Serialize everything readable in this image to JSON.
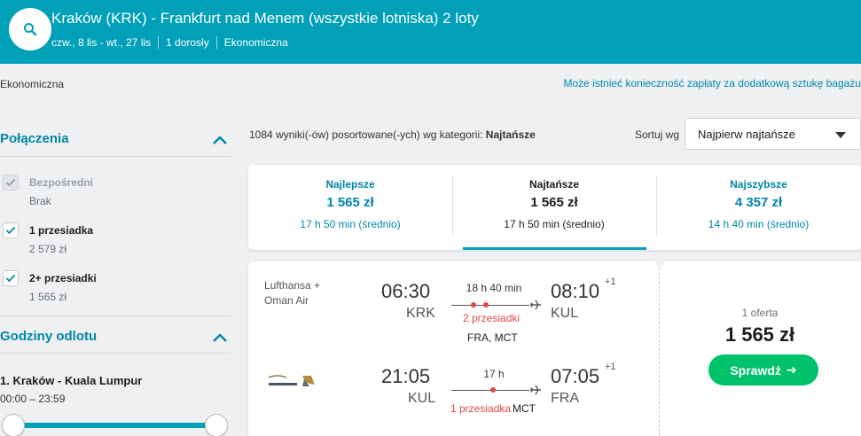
{
  "header": {
    "title": "Kraków (KRK) - Frankfurt nad Menem (wszystkie lotniska) 2 loty",
    "dates": "czw., 8 lis - wt., 27 lis",
    "travelers": "1 dorosły",
    "cabin": "Ekonomiczna"
  },
  "cabin_label": "Ekonomiczna",
  "bag_notice": "Może istnieć konieczność zapłaty za dodatkową sztukę bagażu",
  "sidebar": {
    "connections_title": "Połączenia",
    "connections": [
      {
        "label": "Bezpośredni",
        "sub": "Brak",
        "checked": true,
        "disabled": true
      },
      {
        "label": "1 przesiadka",
        "sub": "2 579 zł",
        "checked": true,
        "disabled": false
      },
      {
        "label": "2+ przesiadki",
        "sub": "1 565 zł",
        "checked": true,
        "disabled": false
      }
    ],
    "departure_title": "Godziny odlotu",
    "route_label": "1. Kraków - Kuala Lumpur",
    "time_range": "00:00 – 23:59"
  },
  "results": {
    "count_text": "1084 wyniki(-ów) posortowane(-ych) wg kategorii: ",
    "sort_category": "Najtańsze",
    "sort_label": "Sortuj wg",
    "sort_value": "Najpierw najtańsze"
  },
  "tabs": [
    {
      "title": "Najlepsze",
      "price": "1 565 zł",
      "duration": "17 h 50 min (średnio)",
      "active": false
    },
    {
      "title": "Najtańsze",
      "price": "1 565 zł",
      "duration": "17 h 50 min (średnio)",
      "active": true
    },
    {
      "title": "Najszybsze",
      "price": "4 357 zł",
      "duration": "14 h 40 min (średnio)",
      "active": false
    }
  ],
  "result": {
    "airline": "Lufthansa +\nOman Air",
    "airline_line1": "Lufthansa +",
    "airline_line2": "Oman Air",
    "legs": [
      {
        "dep_time": "06:30",
        "dep_code": "KRK",
        "arr_time": "08:10",
        "arr_code": "KUL",
        "plus_day": "+1",
        "duration": "18 h 40 min",
        "stops_text": "2 przesiadki",
        "stops_codes": "FRA, MCT"
      },
      {
        "dep_time": "21:05",
        "dep_code": "KUL",
        "arr_time": "07:05",
        "arr_code": "FRA",
        "plus_day": "+1",
        "duration": "17 h",
        "stops_text": "1 przesiadka",
        "stops_codes": "MCT"
      }
    ],
    "offer_count": "1 oferta",
    "price": "1 565 zł",
    "cta": "Sprawdź"
  },
  "colors": {
    "brand": "#00a0b8",
    "link": "#0087a8",
    "stops": "#e14848",
    "cta": "#00c26a"
  }
}
